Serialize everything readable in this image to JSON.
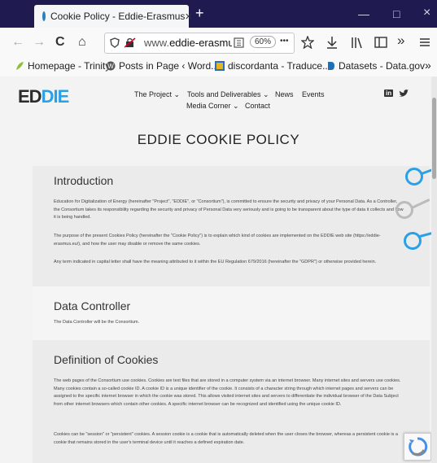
{
  "browser": {
    "tab_title": "Cookie Policy - Eddie-Erasmus",
    "url_prefix": "www.",
    "url_domain": "eddie-erasmu",
    "zoom": "60%",
    "newtab": "+",
    "close": "×",
    "minimize": "—",
    "maximize": "□",
    "window_close": "×",
    "back": "←",
    "forward": "→",
    "reload": "C",
    "home": "⌂",
    "more": "•••",
    "overflow": "»"
  },
  "bookmarks": [
    {
      "label": "Homepage - Trinity"
    },
    {
      "label": "Posts in Page ‹ Word..."
    },
    {
      "label": "discordanta - Traduce..."
    },
    {
      "label": "Datasets - Data.gov"
    }
  ],
  "site": {
    "logo_left": "ED",
    "logo_i": "DI",
    "logo_right": "E",
    "nav": {
      "project": "The Project ⌄",
      "tools": "Tools and Deliverables ⌄",
      "news": "News",
      "events": "Events",
      "media": "Media Corner ⌄",
      "contact": "Contact"
    },
    "social_in": "in",
    "social_tw": "♥",
    "page_title": "EDDIE COOKIE POLICY"
  },
  "sections": {
    "intro": {
      "heading": "Introduction",
      "p1": "Education for Digitalization of Energy (hereinafter \"Project\", \"EDDIE\", or \"Consortium\"), is committed to ensure the security and privacy of your Personal Data. As a Controller, the Consortium takes its responsibility regarding the security and privacy of Personal Data very seriously and is going to be transparent about the type of data it collects and how it is being handled.",
      "p2": "The purpose of the present Cookies Policy (hereinafter the \"Cookie Policy\") is to explain which kind of cookies are implemented on the EDDIE web site (https://eddie-erasmus.eu/), and how the user may disable or remove the same cookies.",
      "p3": "Any term indicated in capital letter shall have the meaning attributed to it within the EU Regulation 679/2016 (hereinafter the \"GDPR\") or otherwise provided herein."
    },
    "controller": {
      "heading": "Data Controller",
      "p1": "The Data Controller will be the Consortium."
    },
    "definition": {
      "heading": "Definition of Cookies",
      "p1": "The web pages of the Consortium use cookies. Cookies are text files that are stored in a computer system via an internet browser. Many internet sites and servers use cookies. Many cookies contain a so-called cookie ID. A cookie ID is a unique identifier of the cookie. It consists of a character string through which internet pages and servers can be assigned to the specific internet browser in which the cookie was stored. This allows visited internet sites and servers to differentiate the individual browser of the Data Subject from other internet browsers which contain other cookies. A specific internet browser can be recognized and identified using the unique cookie ID.",
      "p2": "Cookies can be \"session\" or \"persistent\" cookies. A session cookie is a cookie that is automatically deleted when the user closes the browser, whereas a persistent cookie is a cookie that remains stored in the user's terminal device until it reaches a defined expiration date."
    }
  }
}
